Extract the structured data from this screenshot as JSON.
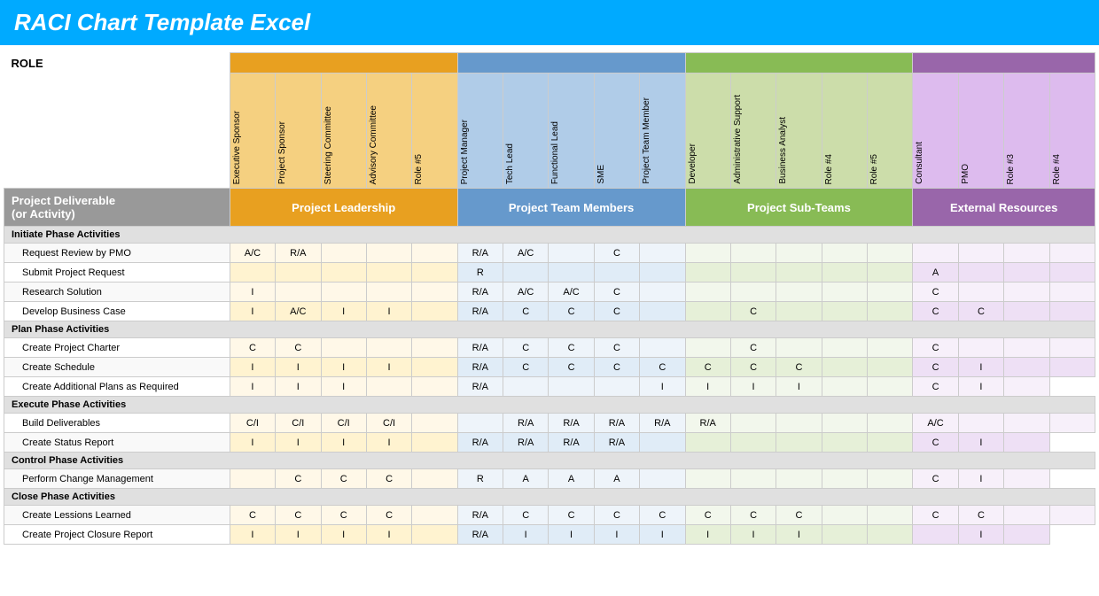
{
  "title": "RACI Chart Template Excel",
  "role_label": "ROLE",
  "deliverable_label": "Project Deliverable\n(or Activity)",
  "group_headers": [
    {
      "label": "Project Leadership",
      "class": "gh-leadership",
      "span": 5
    },
    {
      "label": "Project Team Members",
      "class": "gh-team",
      "span": 5
    },
    {
      "label": "Project Sub-Teams",
      "class": "gh-subteams",
      "span": 5
    },
    {
      "label": "External Resources",
      "class": "gh-external",
      "span": 5
    }
  ],
  "columns": [
    {
      "label": "Executive Sponsor",
      "group": "leadership"
    },
    {
      "label": "Project Sponsor",
      "group": "leadership"
    },
    {
      "label": "Steering Committee",
      "group": "leadership"
    },
    {
      "label": "Advisory Committee",
      "group": "leadership"
    },
    {
      "label": "Role #5",
      "group": "leadership"
    },
    {
      "label": "Project Manager",
      "group": "team"
    },
    {
      "label": "Tech Lead",
      "group": "team"
    },
    {
      "label": "Functional Lead",
      "group": "team"
    },
    {
      "label": "SME",
      "group": "team"
    },
    {
      "label": "Project Team Member",
      "group": "team"
    },
    {
      "label": "Developer",
      "group": "subteams"
    },
    {
      "label": "Administrative Support",
      "group": "subteams"
    },
    {
      "label": "Business Analyst",
      "group": "subteams"
    },
    {
      "label": "Role #4",
      "group": "subteams"
    },
    {
      "label": "Role #5",
      "group": "subteams"
    },
    {
      "label": "Consultant",
      "group": "external"
    },
    {
      "label": "PMO",
      "group": "external"
    },
    {
      "label": "Role #3",
      "group": "external"
    },
    {
      "label": "Role #4",
      "group": "external"
    }
  ],
  "sections": [
    {
      "label": "Initiate Phase Activities",
      "rows": [
        {
          "activity": "Request Review by PMO",
          "values": [
            "A/C",
            "R/A",
            "",
            "",
            "",
            "R/A",
            "A/C",
            "",
            "C",
            "",
            "",
            "",
            "",
            "",
            "",
            "",
            "",
            "",
            ""
          ]
        },
        {
          "activity": "Submit Project Request",
          "values": [
            "",
            "",
            "",
            "",
            "",
            "R",
            "",
            "",
            "",
            "",
            "",
            "",
            "",
            "",
            "",
            "A",
            "",
            "",
            ""
          ]
        },
        {
          "activity": "Research Solution",
          "values": [
            "I",
            "",
            "",
            "",
            "",
            "R/A",
            "A/C",
            "A/C",
            "C",
            "",
            "",
            "",
            "",
            "",
            "",
            "C",
            "",
            "",
            ""
          ]
        },
        {
          "activity": "Develop Business Case",
          "values": [
            "I",
            "A/C",
            "I",
            "I",
            "",
            "R/A",
            "C",
            "C",
            "C",
            "",
            "",
            "C",
            "",
            "",
            "",
            "C",
            "C",
            "",
            ""
          ]
        }
      ]
    },
    {
      "label": "Plan Phase Activities",
      "rows": [
        {
          "activity": "Create Project Charter",
          "values": [
            "C",
            "C",
            "",
            "",
            "",
            "R/A",
            "C",
            "C",
            "C",
            "",
            "",
            "C",
            "",
            "",
            "",
            "C",
            "",
            "",
            ""
          ]
        },
        {
          "activity": "Create Schedule",
          "values": [
            "I",
            "I",
            "I",
            "I",
            "",
            "R/A",
            "C",
            "C",
            "C",
            "C",
            "C",
            "C",
            "C",
            "",
            "",
            "C",
            "I",
            "",
            ""
          ]
        },
        {
          "activity": "Create Additional Plans as Required",
          "values": [
            "I",
            "I",
            "I",
            "",
            "",
            "R/A",
            "",
            "",
            "",
            "I",
            "I",
            "I",
            "I",
            "",
            "",
            "C",
            "I",
            ""
          ]
        }
      ]
    },
    {
      "label": "Execute Phase Activities",
      "rows": [
        {
          "activity": "Build Deliverables",
          "values": [
            "C/I",
            "C/I",
            "C/I",
            "C/I",
            "",
            "",
            "R/A",
            "R/A",
            "R/A",
            "R/A",
            "R/A",
            "",
            "",
            "",
            "",
            "A/C",
            "",
            "",
            ""
          ]
        },
        {
          "activity": "Create Status Report",
          "values": [
            "I",
            "I",
            "I",
            "I",
            "",
            "R/A",
            "R/A",
            "R/A",
            "R/A",
            "",
            "",
            "",
            "",
            "",
            "",
            "C",
            "I",
            ""
          ]
        }
      ]
    },
    {
      "label": "Control Phase Activities",
      "rows": [
        {
          "activity": "Perform Change Management",
          "values": [
            "",
            "C",
            "C",
            "C",
            "",
            "R",
            "A",
            "A",
            "A",
            "",
            "",
            "",
            "",
            "",
            "",
            "C",
            "I",
            ""
          ]
        }
      ]
    },
    {
      "label": "Close Phase Activities",
      "rows": [
        {
          "activity": "Create Lessions Learned",
          "values": [
            "C",
            "C",
            "C",
            "C",
            "",
            "R/A",
            "C",
            "C",
            "C",
            "C",
            "C",
            "C",
            "C",
            "",
            "",
            "C",
            "C",
            "",
            ""
          ]
        },
        {
          "activity": "Create Project Closure Report",
          "values": [
            "I",
            "I",
            "I",
            "I",
            "",
            "R/A",
            "I",
            "I",
            "I",
            "I",
            "I",
            "I",
            "I",
            "",
            "",
            "",
            "I",
            ""
          ]
        }
      ]
    }
  ]
}
